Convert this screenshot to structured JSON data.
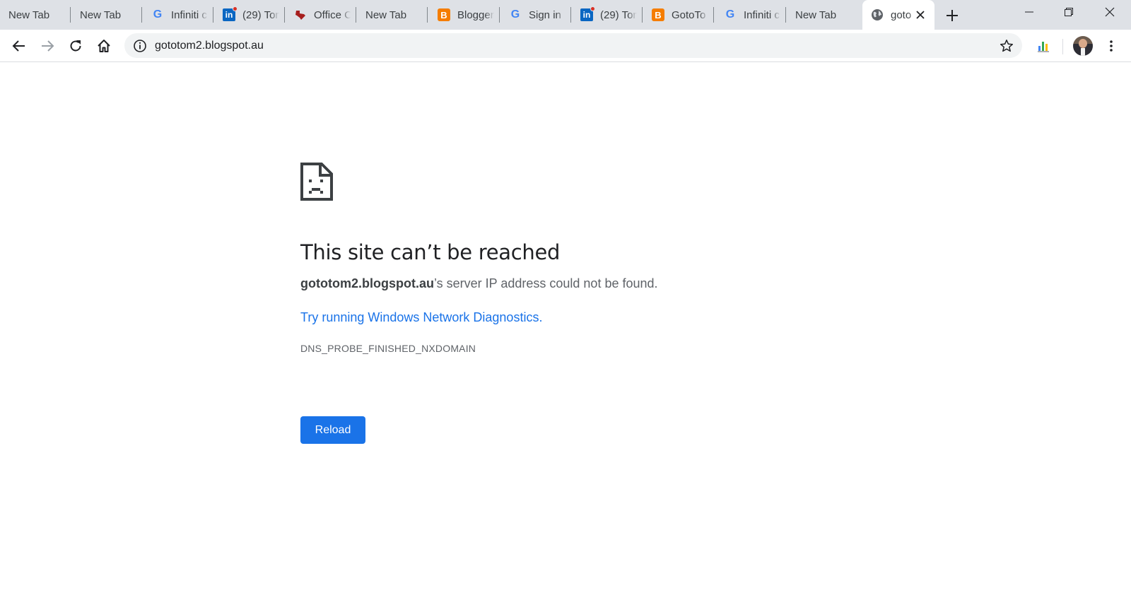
{
  "tabs": [
    {
      "title": "New Tab",
      "icon": "none"
    },
    {
      "title": "New Tab",
      "icon": "none"
    },
    {
      "title": "Infiniti c",
      "icon": "google-icon"
    },
    {
      "title": "(29) Tom",
      "icon": "linkedin-icon"
    },
    {
      "title": "Office C",
      "icon": "texas-icon"
    },
    {
      "title": "New Tab",
      "icon": "none"
    },
    {
      "title": "Blogger",
      "icon": "blogger-icon"
    },
    {
      "title": "Sign in",
      "icon": "google-icon"
    },
    {
      "title": "(29) Tom",
      "icon": "linkedin-icon"
    },
    {
      "title": "GotoTo",
      "icon": "blogger-icon"
    },
    {
      "title": "Infiniti c",
      "icon": "google-icon"
    },
    {
      "title": "New Tab",
      "icon": "none"
    }
  ],
  "active_tab": {
    "title": "goto",
    "icon": "globe-icon"
  },
  "favicon_letters": {
    "google": "G",
    "linkedin": "in",
    "blogger": "B"
  },
  "address_bar": {
    "url": "gototom2.blogspot.au"
  },
  "error": {
    "heading": "This site can’t be reached",
    "host": "gototom2.blogspot.au",
    "message_suffix": "’s server IP address could not be found.",
    "diagnostics_link": "Try running Windows Network Diagnostics.",
    "error_code": "DNS_PROBE_FINISHED_NXDOMAIN",
    "reload_label": "Reload"
  },
  "colors": {
    "tabstrip": "#dee1e6",
    "accent": "#1a73e8",
    "text": "#202124",
    "secondary": "#5f6368"
  }
}
